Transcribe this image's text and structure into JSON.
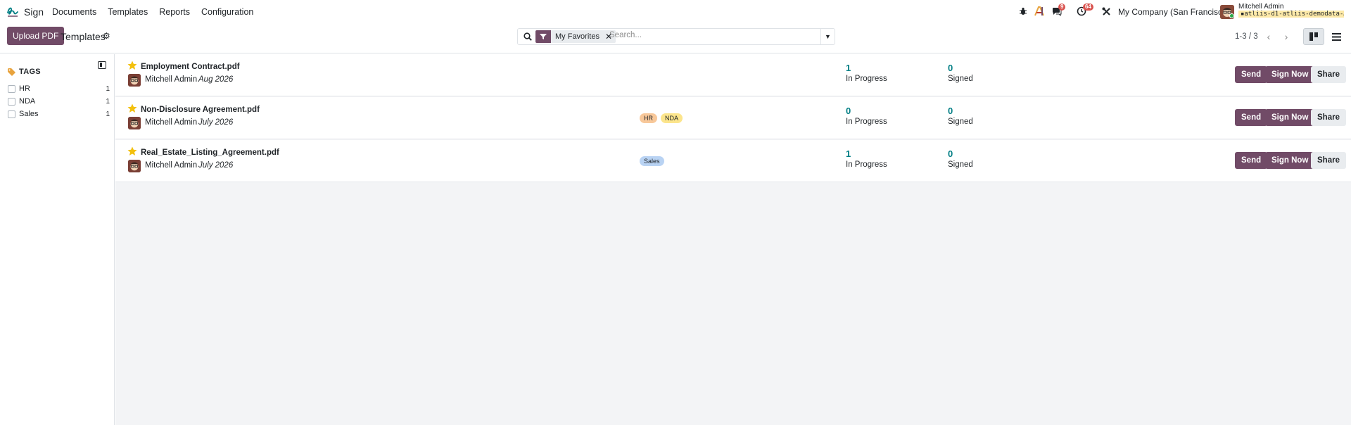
{
  "navbar": {
    "app_name": "Sign",
    "menu": [
      "Documents",
      "Templates",
      "Reports",
      "Configuration"
    ],
    "messages_badge": "9",
    "activities_badge": "64",
    "company": "My Company (San Francisco)",
    "user_name": "Mitchell Admin",
    "database": "atliis-d1-atliis-demodata-…"
  },
  "control_panel": {
    "upload_label": "Upload PDF",
    "title": "Templates",
    "facet_label": "My Favorites",
    "search_placeholder": "Search...",
    "pager": "1-3 / 3"
  },
  "sidebar": {
    "heading": "TAGS",
    "tags": [
      {
        "label": "HR",
        "count": "1"
      },
      {
        "label": "NDA",
        "count": "1"
      },
      {
        "label": "Sales",
        "count": "1"
      }
    ]
  },
  "records": [
    {
      "name": "Employment Contract.pdf",
      "user": "Mitchell Admin",
      "date": "Aug 2026",
      "tags": [],
      "in_progress": "1",
      "in_progress_label": "In Progress",
      "signed": "0",
      "signed_label": "Signed"
    },
    {
      "name": "Non-Disclosure Agreement.pdf",
      "user": "Mitchell Admin",
      "date": "July 2026",
      "tags": [
        "HR",
        "NDA"
      ],
      "in_progress": "0",
      "in_progress_label": "In Progress",
      "signed": "0",
      "signed_label": "Signed"
    },
    {
      "name": "Real_Estate_Listing_Agreement.pdf",
      "user": "Mitchell Admin",
      "date": "July 2026",
      "tags": [
        "Sales"
      ],
      "in_progress": "1",
      "in_progress_label": "In Progress",
      "signed": "0",
      "signed_label": "Signed"
    }
  ],
  "actions": {
    "send": "Send",
    "sign_now": "Sign Now",
    "share": "Share"
  },
  "colors": {
    "brand": "#714B67",
    "stat": "#017e84",
    "star": "#f3c00d",
    "tag_hr": "#f8c89a",
    "tag_nda": "#fce58c",
    "tag_sales": "#b9d3f3"
  }
}
